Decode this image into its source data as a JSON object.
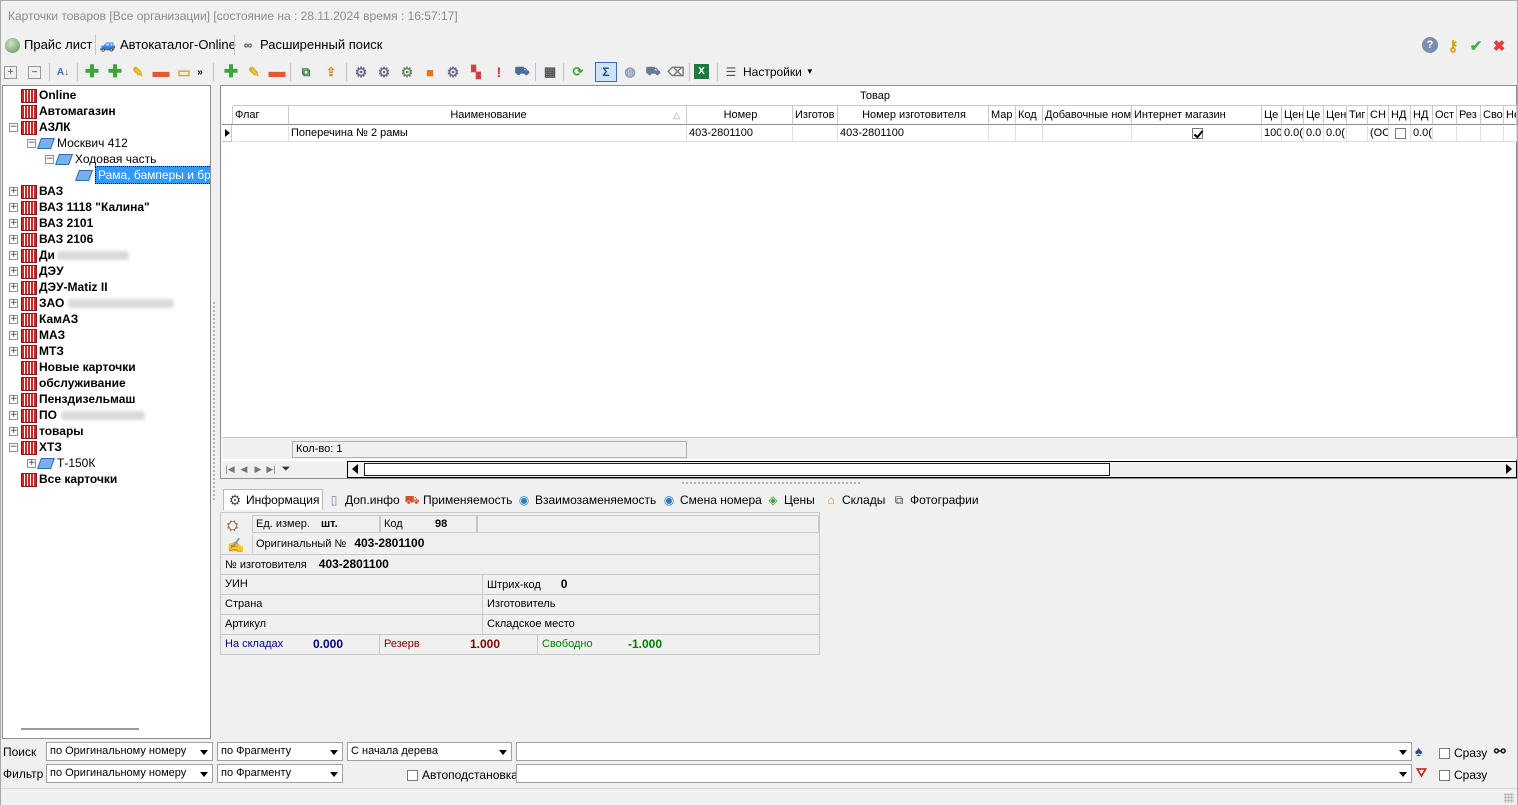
{
  "window": {
    "title": "Карточки товаров  [Все организации] [состояние на : 28.11.2024  время : 16:57:17]"
  },
  "menubar": {
    "items": [
      {
        "label": "Прайс лист",
        "icon": "globe-icon"
      },
      {
        "label": "Автокаталог-Online",
        "icon": "car-icon"
      },
      {
        "label": "Расширенный поиск",
        "icon": "binoculars-icon"
      }
    ],
    "right_icons": [
      "help-icon",
      "key-icon",
      "ok-check-icon",
      "close-x-icon"
    ]
  },
  "toolbar": {
    "settings_label": "Настройки"
  },
  "tree": {
    "nodes": [
      {
        "label": "Online",
        "bold": true
      },
      {
        "label": "Автомагазин",
        "bold": true
      },
      {
        "label": "АЗЛК",
        "bold": true
      },
      {
        "label": "Москвич 412",
        "bold": false
      },
      {
        "label": "Ходовая часть",
        "bold": false
      },
      {
        "label": "Рама, бамперы и бры",
        "bold": false
      },
      {
        "label": "ВАЗ",
        "bold": true
      },
      {
        "label": "ВАЗ 1118 \"Калина\"",
        "bold": true
      },
      {
        "label": "ВАЗ 2101",
        "bold": true
      },
      {
        "label": "ВАЗ 2106",
        "bold": true
      },
      {
        "label": "Ди",
        "bold": true
      },
      {
        "label": "ДЭУ",
        "bold": true
      },
      {
        "label": "ДЭУ-Matiz II",
        "bold": true
      },
      {
        "label": "ЗАО",
        "bold": true
      },
      {
        "label": "КамАЗ",
        "bold": true
      },
      {
        "label": "МАЗ",
        "bold": true
      },
      {
        "label": "МТЗ",
        "bold": true
      },
      {
        "label": "Новые карточки",
        "bold": true
      },
      {
        "label": "обслуживание",
        "bold": true
      },
      {
        "label": "Пенздизельмаш",
        "bold": true
      },
      {
        "label": "ПО",
        "bold": true
      },
      {
        "label": "товары",
        "bold": true
      },
      {
        "label": "ХТЗ",
        "bold": true
      },
      {
        "label": "Т-150К",
        "bold": false
      },
      {
        "label": "Все карточки",
        "bold": true
      }
    ]
  },
  "grid": {
    "caption": "Товар",
    "columns": [
      "Флаг",
      "Наименование",
      "Номер",
      "Изготов",
      "Номер изготовителя",
      "Мар",
      "Код",
      "Добавочные ном",
      "Интернет магазин",
      "Це",
      "Цен",
      "Це",
      "Цен",
      "Тиг",
      "СН",
      "НД",
      "НД",
      "Ост",
      "Рез",
      "Сво",
      "Не"
    ],
    "rows": [
      {
        "flag": "",
        "name": "Поперечина № 2 рамы",
        "number": "403-2801100",
        "maker": "",
        "maker_number": "403-2801100",
        "mark": "",
        "code": "",
        "extra_numbers": "",
        "internet_shop": true,
        "c1": "100",
        "c2": "0.0(",
        "c3": "0.0",
        "c4": "0.0(",
        "type": "",
        "sn": "(ОС",
        "nd_check": false,
        "nd": "0.0("
      }
    ],
    "count_label": "Кол-во: 1"
  },
  "tabs": [
    {
      "label": "Информация",
      "icon": "gears-icon",
      "active": true
    },
    {
      "label": "Доп.инфо",
      "icon": "document-icon",
      "active": false
    },
    {
      "label": "Применяемость",
      "icon": "truck-icon",
      "active": false
    },
    {
      "label": "Взаимозаменяемость",
      "icon": "exchange-icon",
      "active": false
    },
    {
      "label": "Смена номера",
      "icon": "renumber-icon",
      "active": false
    },
    {
      "label": "Цены",
      "icon": "price-tag-icon",
      "active": false
    },
    {
      "label": "Склады",
      "icon": "warehouse-icon",
      "active": false
    },
    {
      "label": "Фотографии",
      "icon": "photos-icon",
      "active": false
    }
  ],
  "info": {
    "unit_label": "Ед. измер.",
    "unit_value": "шт.",
    "code_label": "Код",
    "code_value": "98",
    "orig_label": "Оригинальный №",
    "orig_value": "403-2801100",
    "maker_num_label": "№ изготовителя",
    "maker_num_value": "403-2801100",
    "uin_label": "УИН",
    "barcode_label": "Штрих-код",
    "barcode_value": "0",
    "country_label": "Страна",
    "maker_label": "Изготовитель",
    "article_label": "Артикул",
    "storage_label": "Складское место",
    "stock_label": "На складах",
    "stock_value": "0.000",
    "reserve_label": "Резерв",
    "reserve_value": "1.000",
    "free_label": "Свободно",
    "free_value": "-1.000",
    "colors": {
      "stock": "#000080",
      "reserve": "#800000",
      "free": "#008000"
    }
  },
  "search": {
    "label": "Поиск",
    "mode": "по Оригинальному номеру",
    "match": "по Фрагменту",
    "scope": "С начала дерева",
    "value": "",
    "instant_label": "Сразу"
  },
  "filter": {
    "label": "Фильтр",
    "mode": "по Оригинальному номеру",
    "match": "по Фрагменту",
    "autosubst_label": "Автоподстановка",
    "value": "",
    "instant_label": "Сразу"
  }
}
